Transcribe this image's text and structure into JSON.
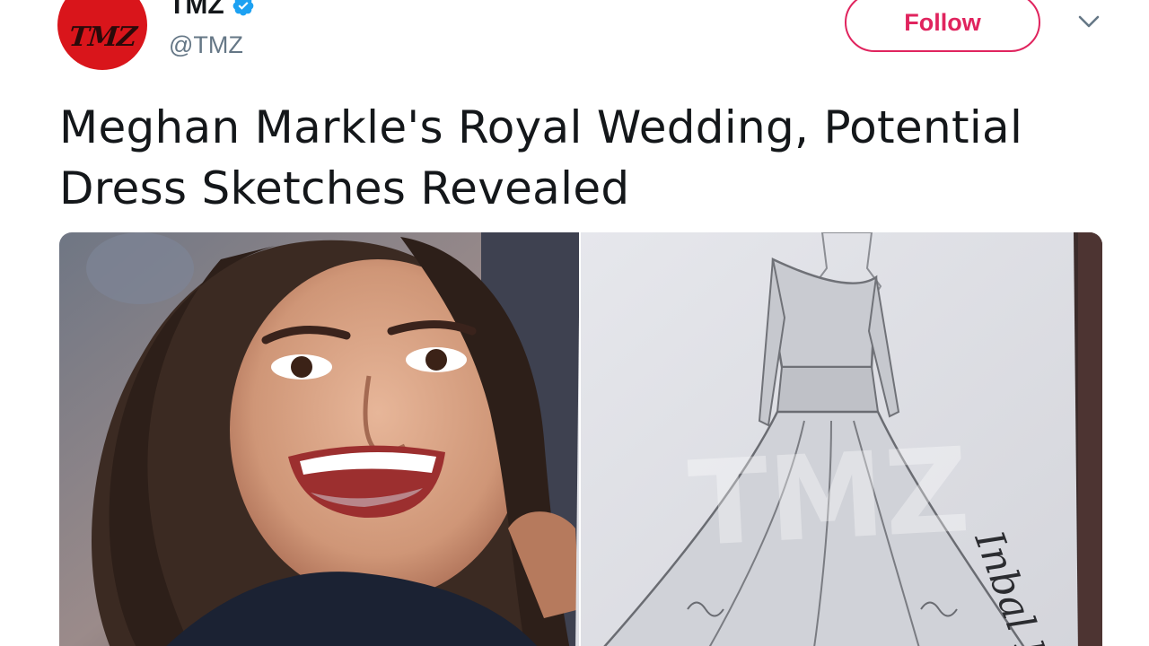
{
  "author": {
    "name": "TMZ",
    "handle": "@TMZ",
    "avatar_logo_text": "TMZ",
    "verified": true,
    "verified_color": "#1da1f2",
    "avatar_color": "#d9151b"
  },
  "actions": {
    "follow_label": "Follow",
    "follow_color": "#e0245e",
    "more_icon": "chevron-down-icon"
  },
  "tweet": {
    "text_line1": "Meghan Markle's Royal Wedding, Potential",
    "text_line2": "Dress Sketches Revealed"
  },
  "media": {
    "watermark_text": "TMZ",
    "signature_text": "Inbal D",
    "left_photo": "woman-smiling-photo",
    "right_photo": "wedding-dress-sketch-photo"
  }
}
